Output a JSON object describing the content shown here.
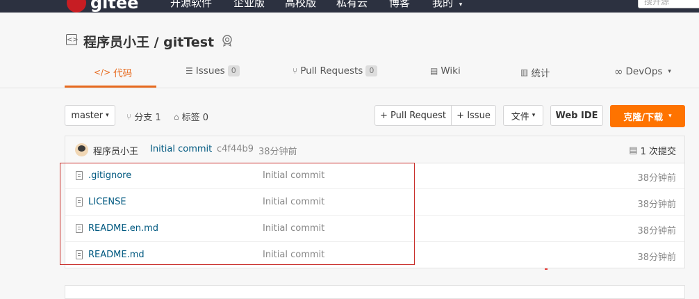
{
  "topnav": {
    "logo": "gitee",
    "items": [
      "开源软件",
      "企业版",
      "高校版",
      "私有云",
      "博客",
      "我的"
    ],
    "search_placeholder": "搜开源"
  },
  "repo": {
    "title": "程序员小王 / gitTest"
  },
  "tabs": [
    {
      "label": "代码",
      "icon": "code-icon",
      "active": true
    },
    {
      "label": "Issues",
      "count": "0",
      "icon": "issues-icon"
    },
    {
      "label": "Pull Requests",
      "count": "0",
      "icon": "pull-request-icon"
    },
    {
      "label": "Wiki",
      "icon": "wiki-icon"
    },
    {
      "label": "统计",
      "icon": "stats-icon"
    },
    {
      "label": "DevOps",
      "icon": "devops-icon"
    }
  ],
  "toolbar": {
    "branch": "master",
    "branches_label": "分支 1",
    "tags_label": "标签 0",
    "pull_request": "+ Pull Request",
    "issue": "+ Issue",
    "file_menu": "文件",
    "web_ide": "Web IDE",
    "clone": "克隆/下载"
  },
  "commit_bar": {
    "user": "程序员小王",
    "message": "Initial commit",
    "hash": "c4f44b9",
    "time": "38分钟前",
    "count": "1 次提交"
  },
  "files": [
    {
      "name": ".gitignore",
      "message": "Initial commit",
      "time": "38分钟前"
    },
    {
      "name": "LICENSE",
      "message": "Initial commit",
      "time": "38分钟前"
    },
    {
      "name": "README.en.md",
      "message": "Initial commit",
      "time": "38分钟前"
    },
    {
      "name": "README.md",
      "message": "Initial commit",
      "time": "38分钟前"
    }
  ],
  "colors": {
    "accent": "#e76a1e",
    "clone_button": "#fe7300",
    "link": "#005980",
    "highlight_box": "#c9302c"
  }
}
